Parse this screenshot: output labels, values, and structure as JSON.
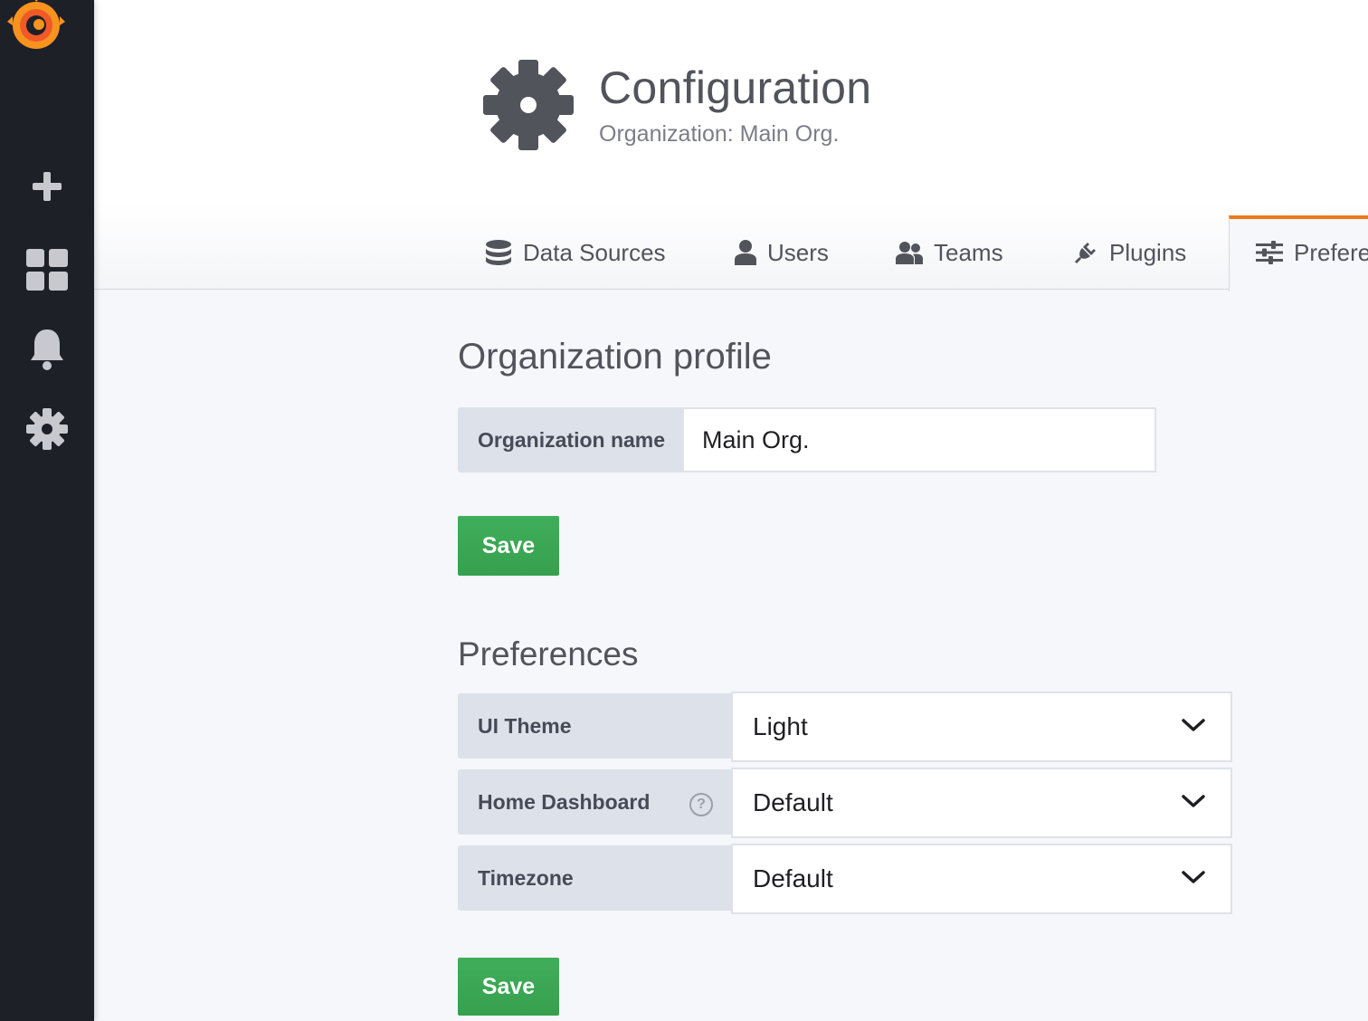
{
  "sidebar": {
    "items": [
      {
        "icon": "plus-icon",
        "label": "Create"
      },
      {
        "icon": "dashboards-icon",
        "label": "Dashboards"
      },
      {
        "icon": "bell-icon",
        "label": "Alerting"
      },
      {
        "icon": "gear-icon",
        "label": "Configuration"
      }
    ]
  },
  "header": {
    "title": "Configuration",
    "subtitle": "Organization: Main Org."
  },
  "tabs": [
    {
      "label": "Data Sources",
      "icon": "database-icon"
    },
    {
      "label": "Users",
      "icon": "user-icon"
    },
    {
      "label": "Teams",
      "icon": "users-icon"
    },
    {
      "label": "Plugins",
      "icon": "plug-icon"
    },
    {
      "label": "Prefere",
      "icon": "sliders-icon",
      "active": true
    }
  ],
  "org_profile": {
    "title": "Organization profile",
    "name_label": "Organization name",
    "name_value": "Main Org.",
    "save_label": "Save"
  },
  "preferences": {
    "title": "Preferences",
    "fields": [
      {
        "label": "UI Theme",
        "value": "Light"
      },
      {
        "label": "Home Dashboard",
        "value": "Default",
        "help": "?"
      },
      {
        "label": "Timezone",
        "value": "Default"
      }
    ],
    "save_label": "Save"
  },
  "colors": {
    "sidebar_bg": "#1e2028",
    "accent": "#eb7b18",
    "save_button": "#3aa655",
    "label_bg": "#dde2ea"
  }
}
